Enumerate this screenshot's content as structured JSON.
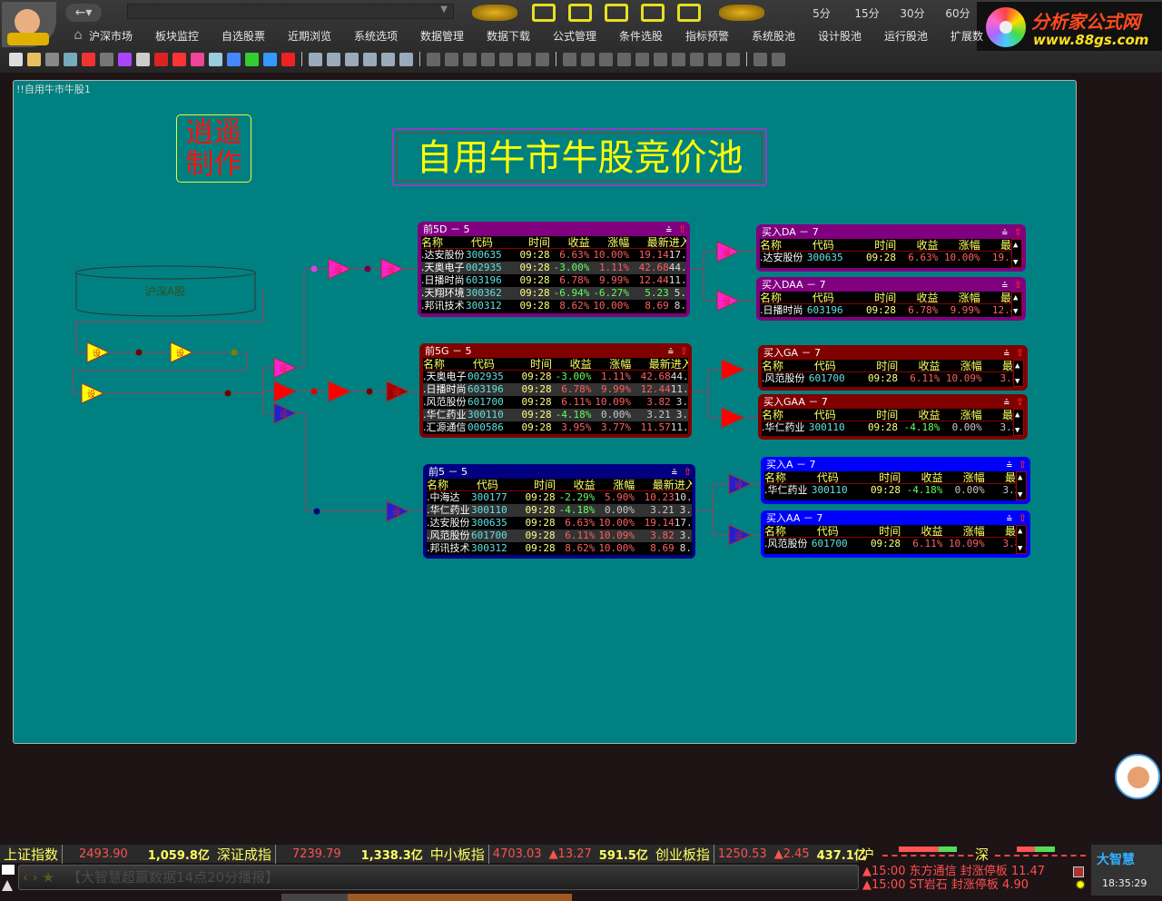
{
  "topbar": {
    "nav_back": "←▾",
    "address_dropdown": "▼",
    "timeframes": [
      "5分",
      "15分",
      "30分",
      "60分"
    ],
    "brand": {
      "name": "分析家公式网",
      "url": "www.88gs.com"
    },
    "menu": [
      "沪深市场",
      "板块监控",
      "自选股票",
      "近期浏览",
      "系统选项",
      "数据管理",
      "数据下载",
      "公式管理",
      "条件选股",
      "指标预警",
      "系统股池",
      "设计股池",
      "运行股池",
      "扩展数"
    ],
    "toolbar_icons": [
      "new-file",
      "open-folder",
      "save",
      "properties",
      "delete",
      "swap",
      "grid",
      "inspect",
      "run",
      "pointer",
      "cylinder",
      "document",
      "play",
      "trash",
      "arrow",
      "numbering",
      "|",
      "text",
      "rect",
      "rounded-rect",
      "circle",
      "triangle",
      "line",
      "|",
      "zoom",
      "fill",
      "square",
      "table",
      "font",
      "copy",
      "paste",
      "|",
      "align-left",
      "align-right",
      "align-center",
      "align-top",
      "align-middle",
      "align-bottom",
      "distribute-h",
      "distribute-v",
      "same-width",
      "same-height",
      "|",
      "fit",
      "close"
    ]
  },
  "canvas": {
    "title": "!!自用牛市牛股1",
    "stamp": [
      "逍遥",
      "制作"
    ],
    "main_title": "自用牛市牛股竞价池",
    "source_label": "沪深A股",
    "node_label": "设",
    "colors": {
      "background": "#008080",
      "purple": "#800080",
      "darkred": "#800000",
      "navy": "#000080",
      "blue": "#0000ff"
    }
  },
  "panels": [
    {
      "title": "前5D － 5",
      "color": "#800080",
      "cols": [
        "名称",
        "代码",
        "时间",
        "收益",
        "涨幅",
        "最新",
        "进入"
      ],
      "rows": [
        [
          ".达安股份",
          "300635",
          "09:28",
          "6.63%",
          "10.00%",
          "19.14",
          "17."
        ],
        [
          ".天奥电子",
          "002935",
          "09:28",
          "-3.00%",
          "1.11%",
          "42.68",
          "44."
        ],
        [
          ".日播时尚",
          "603196",
          "09:28",
          "6.78%",
          "9.99%",
          "12.44",
          "11."
        ],
        [
          ".天翔环境",
          "300362",
          "09:28",
          "-6.94%",
          "-6.27%",
          "5.23",
          "5."
        ],
        [
          ".邦讯技术",
          "300312",
          "09:28",
          "8.62%",
          "10.00%",
          "8.69",
          "8."
        ]
      ]
    },
    {
      "title": "前5G － 5",
      "color": "#800000",
      "cols": [
        "名称",
        "代码",
        "时间",
        "收益",
        "涨幅",
        "最新",
        "进入"
      ],
      "rows": [
        [
          ".天奥电子",
          "002935",
          "09:28",
          "-3.00%",
          "1.11%",
          "42.68",
          "44."
        ],
        [
          ".日播时尚",
          "603196",
          "09:28",
          "6.78%",
          "9.99%",
          "12.44",
          "11."
        ],
        [
          ".风范股份",
          "601700",
          "09:28",
          "6.11%",
          "10.09%",
          "3.82",
          "3."
        ],
        [
          ".华仁药业",
          "300110",
          "09:28",
          "-4.18%",
          "0.00%",
          "3.21",
          "3."
        ],
        [
          ".汇源通信",
          "000586",
          "09:28",
          "3.95%",
          "3.77%",
          "11.57",
          "11."
        ]
      ]
    },
    {
      "title": "前5 － 5",
      "color": "#000080",
      "cols": [
        "名称",
        "代码",
        "时间",
        "收益",
        "涨幅",
        "最新",
        "进入"
      ],
      "rows": [
        [
          ".中海达",
          "300177",
          "09:28",
          "-2.29%",
          "5.90%",
          "10.23",
          "10."
        ],
        [
          ".华仁药业",
          "300110",
          "09:28",
          "-4.18%",
          "0.00%",
          "3.21",
          "3."
        ],
        [
          ".达安股份",
          "300635",
          "09:28",
          "6.63%",
          "10.00%",
          "19.14",
          "17."
        ],
        [
          ".风范股份",
          "601700",
          "09:28",
          "6.11%",
          "10.09%",
          "3.82",
          "3."
        ],
        [
          ".邦讯技术",
          "300312",
          "09:28",
          "8.62%",
          "10.00%",
          "8.69",
          "8."
        ]
      ]
    },
    {
      "title": "买入DA － 7",
      "color": "#800080",
      "cols": [
        "名称",
        "代码",
        "时间",
        "收益",
        "涨幅",
        "最新"
      ],
      "rows": [
        [
          ".达安股份",
          "300635",
          "09:28",
          "6.63%",
          "10.00%",
          "19.14"
        ]
      ]
    },
    {
      "title": "买入DAA － 7",
      "color": "#800080",
      "cols": [
        "名称",
        "代码",
        "时间",
        "收益",
        "涨幅",
        "最新"
      ],
      "rows": [
        [
          ".日播时尚",
          "603196",
          "09:28",
          "6.78%",
          "9.99%",
          "12.44"
        ]
      ]
    },
    {
      "title": "买入GA － 7",
      "color": "#800000",
      "cols": [
        "名称",
        "代码",
        "时间",
        "收益",
        "涨幅",
        "最新"
      ],
      "rows": [
        [
          ".风范股份",
          "601700",
          "09:28",
          "6.11%",
          "10.09%",
          "3.82"
        ]
      ]
    },
    {
      "title": "买入GAA － 7",
      "color": "#800000",
      "cols": [
        "名称",
        "代码",
        "时间",
        "收益",
        "涨幅",
        "最新"
      ],
      "rows": [
        [
          ".华仁药业",
          "300110",
          "09:28",
          "-4.18%",
          "0.00%",
          "3.21"
        ]
      ]
    },
    {
      "title": "买入A － 7",
      "color": "#0000ff",
      "cols": [
        "名称",
        "代码",
        "时间",
        "收益",
        "涨幅",
        "最新"
      ],
      "rows": [
        [
          ".华仁药业",
          "300110",
          "09:28",
          "-4.18%",
          "0.00%",
          "3.21"
        ]
      ]
    },
    {
      "title": "买入AA － 7",
      "color": "#0000ff",
      "cols": [
        "名称",
        "代码",
        "时间",
        "收益",
        "涨幅",
        "最新"
      ],
      "rows": [
        [
          ".风范股份",
          "601700",
          "09:28",
          "6.11%",
          "10.09%",
          "3.82"
        ]
      ]
    }
  ],
  "statusbar": {
    "indices": [
      {
        "name": "上证指数",
        "value": "2493.90",
        "change": "",
        "volume": "1,059.8亿"
      },
      {
        "name": "深证成指",
        "value": "7239.79",
        "change": "",
        "volume": "1,338.3亿"
      },
      {
        "name": "中小板指",
        "value": "4703.03",
        "change": "▲13.27",
        "volume": "591.5亿"
      },
      {
        "name": "创业板指",
        "value": "1250.53",
        "change": "▲2.45",
        "volume": "437.1亿"
      }
    ],
    "market_sh": "沪",
    "market_sz": "深",
    "ticker_nav": "‹ › ★",
    "ticker": "【大智慧超赢数据14点20分播报】",
    "alerts": [
      "▲15:00 东方通信 封涨停板 11.47",
      "▲15:00 ST岩石  封涨停板 4.90"
    ],
    "app_logo": "大智慧",
    "clock": "18:35:29"
  }
}
